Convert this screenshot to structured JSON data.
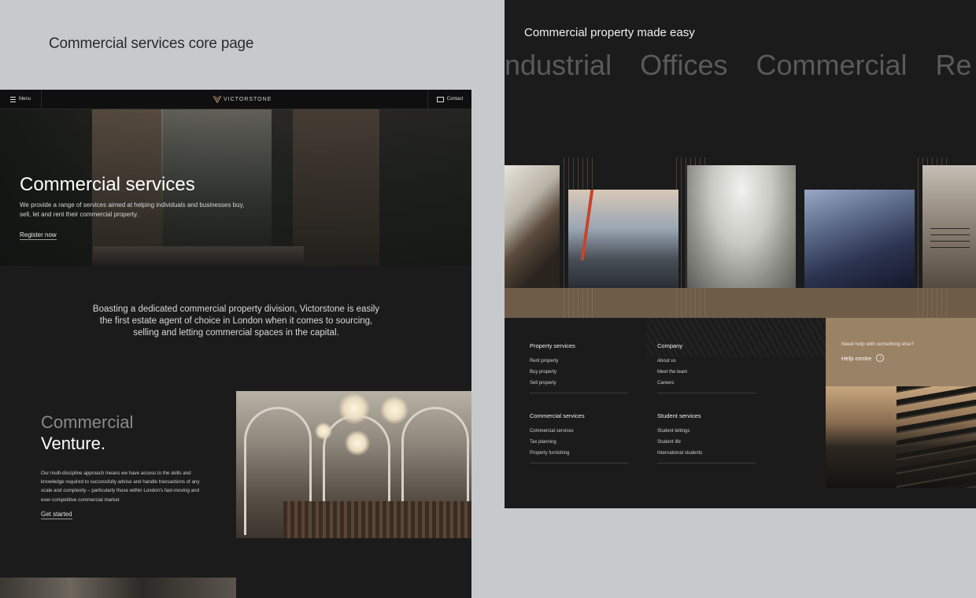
{
  "canvas_title": "Commercial services core page",
  "header": {
    "menu_label": "Menu",
    "logo_text": "VICTORSTONE",
    "contact_label": "Contact"
  },
  "hero": {
    "title": "Commercial services",
    "text": "We provide a range of services aimed at helping individuals and businesses buy, sell, let and rent their commercial property.",
    "cta": "Register now"
  },
  "intro": {
    "text": "Boasting a dedicated commercial property division, Victorstone is easily the first estate agent of choice in London when it comes to sourcing, selling and letting commercial spaces in the capital."
  },
  "venture": {
    "title_line1": "Commercial",
    "title_line2": "Venture.",
    "text": "Our multi-discipline approach means we have access to the skills and knowledge required to successfully advise and handle transactions of any scale and complexity – particularly those within London's fast-moving and ever-competitive commercial market.",
    "cta": "Get started"
  },
  "right_panel": {
    "title": "Commercial property made easy",
    "marquee": [
      "ndustrial",
      "Offices",
      "Commercial",
      "Re"
    ]
  },
  "footer": {
    "columns": [
      {
        "heading": "Property services",
        "items": [
          "Rent property",
          "Buy property",
          "Sell property"
        ]
      },
      {
        "heading": "Company",
        "items": [
          "About us",
          "Meet the team",
          "Careers"
        ]
      },
      {
        "heading": "Commercial services",
        "items": [
          "Commercial services",
          "Tax planning",
          "Property furnishing"
        ]
      },
      {
        "heading": "Student services",
        "items": [
          "Student lettings",
          "Student life",
          "International students"
        ]
      }
    ],
    "help": {
      "question": "Need help with something else?",
      "link": "Help centre"
    }
  },
  "colors": {
    "background": "#c6cacd",
    "panel": "#1b1b1b",
    "accent_brown": "#9a8266",
    "band_brown": "#6f5c48"
  }
}
